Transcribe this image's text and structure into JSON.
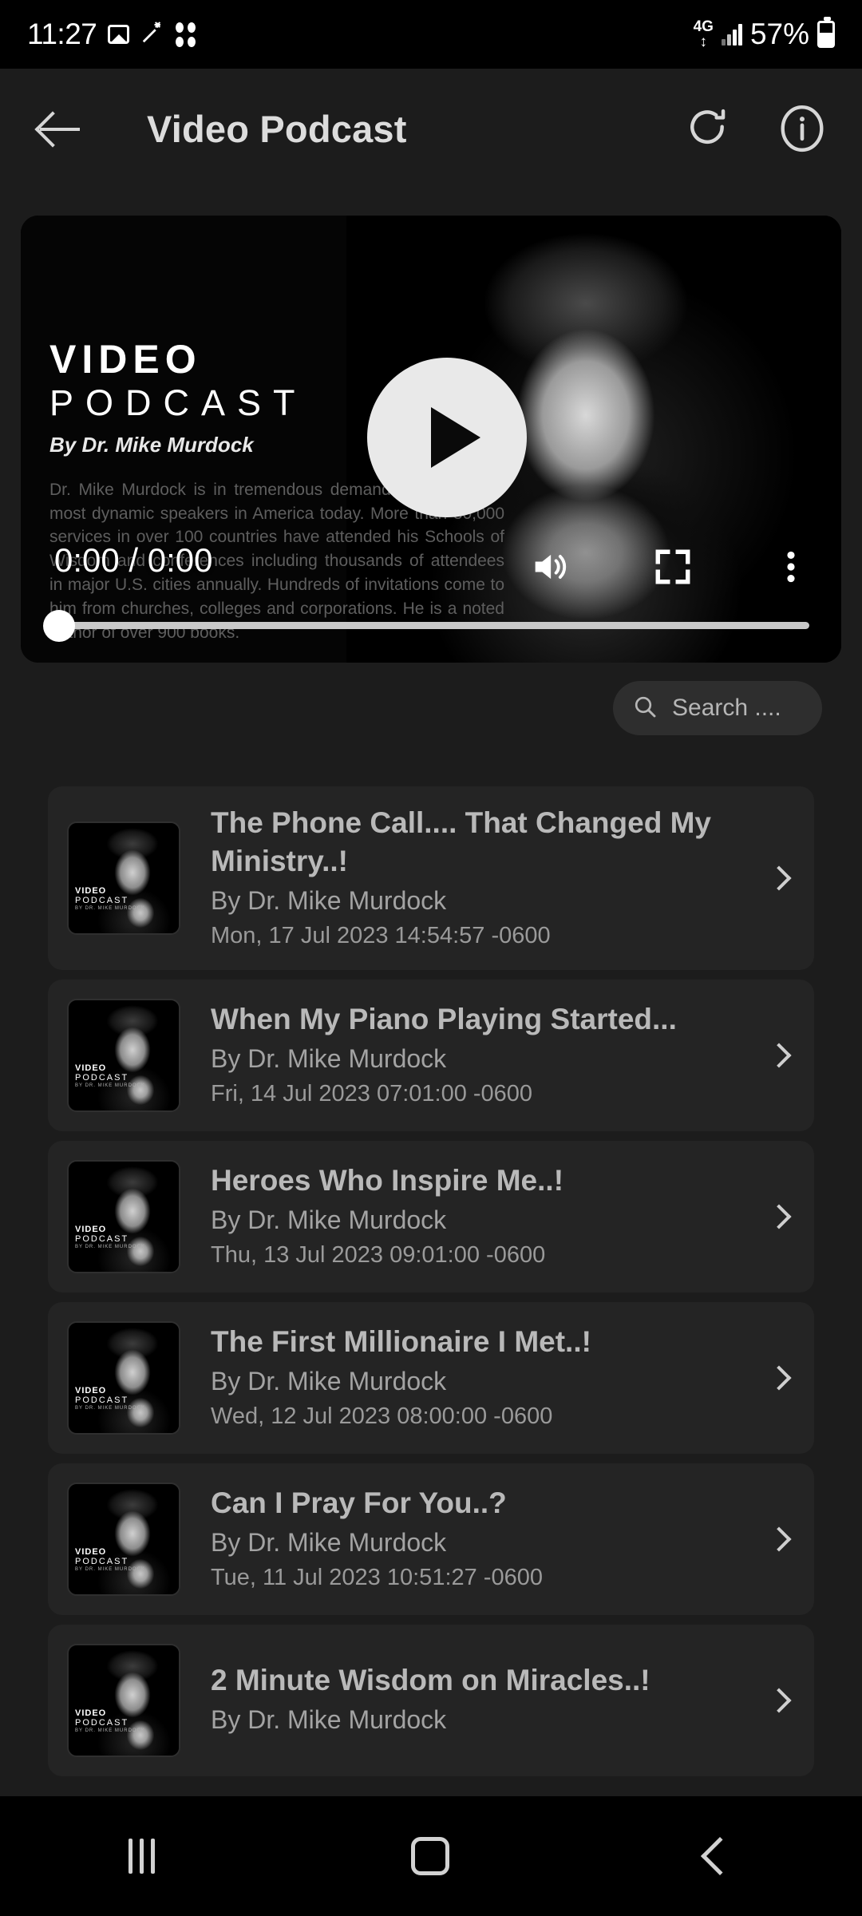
{
  "status_bar": {
    "time": "11:27",
    "icons": [
      "image-icon",
      "magic-wand-icon",
      "download-dots-icon"
    ],
    "network": "4G",
    "battery_percent": "57%"
  },
  "app_bar": {
    "back_icon": "back-arrow-icon",
    "title": "Video Podcast",
    "refresh_icon": "refresh-icon",
    "info_icon": "info-icon"
  },
  "player": {
    "poster": {
      "line1": "VIDEO",
      "line2": "PODCAST",
      "byline": "By Dr. Mike Murdock",
      "description": "Dr. Mike Murdock is in tremendous demand as one of the most dynamic speakers in America today. More than 30,000 services in over 100 countries have attended his Schools of Wisdom and conferences including thousands of attendees in major U.S. cities annually. Hundreds of invitations come to him from churches, colleges and corporations. He is a noted author of over 900 books."
    },
    "play_icon": "play-icon",
    "current_time": "0:00",
    "separator": "/",
    "duration": "0:00",
    "time_display": "0:00 / 0:00",
    "volume_icon": "volume-icon",
    "fullscreen_icon": "fullscreen-icon",
    "more_icon": "more-vertical-icon",
    "progress_percent": 0
  },
  "search": {
    "icon": "search-icon",
    "placeholder": "Search ...."
  },
  "thumbnail": {
    "line1": "VIDEO",
    "line2": "PODCAST",
    "line3": "BY DR. MIKE MURDOCK"
  },
  "episodes": [
    {
      "title": "The Phone Call.... That Changed My Ministry..!",
      "author": "By Dr. Mike Murdock",
      "date": "Mon, 17 Jul 2023 14:54:57 -0600"
    },
    {
      "title": "When My Piano Playing Started...",
      "author": "By Dr. Mike Murdock",
      "date": "Fri, 14 Jul 2023 07:01:00 -0600"
    },
    {
      "title": "Heroes Who Inspire Me..!",
      "author": "By Dr. Mike Murdock",
      "date": "Thu, 13 Jul 2023 09:01:00 -0600"
    },
    {
      "title": "The First Millionaire I Met..!",
      "author": "By Dr. Mike Murdock",
      "date": "Wed, 12 Jul 2023 08:00:00 -0600"
    },
    {
      "title": "Can I Pray For You..?",
      "author": "By Dr. Mike Murdock",
      "date": "Tue, 11 Jul 2023 10:51:27 -0600"
    },
    {
      "title": "2 Minute Wisdom on Miracles..!",
      "author": "By Dr. Mike Murdock",
      "date": ""
    }
  ],
  "nav_bar": {
    "recents_icon": "recents-icon",
    "home_icon": "home-icon",
    "back_icon": "nav-back-icon"
  },
  "colors": {
    "page_bg": "#1c1c1c",
    "card_bg": "#242424",
    "accent_text": "#b9b9b9",
    "system_bar": "#000000"
  }
}
